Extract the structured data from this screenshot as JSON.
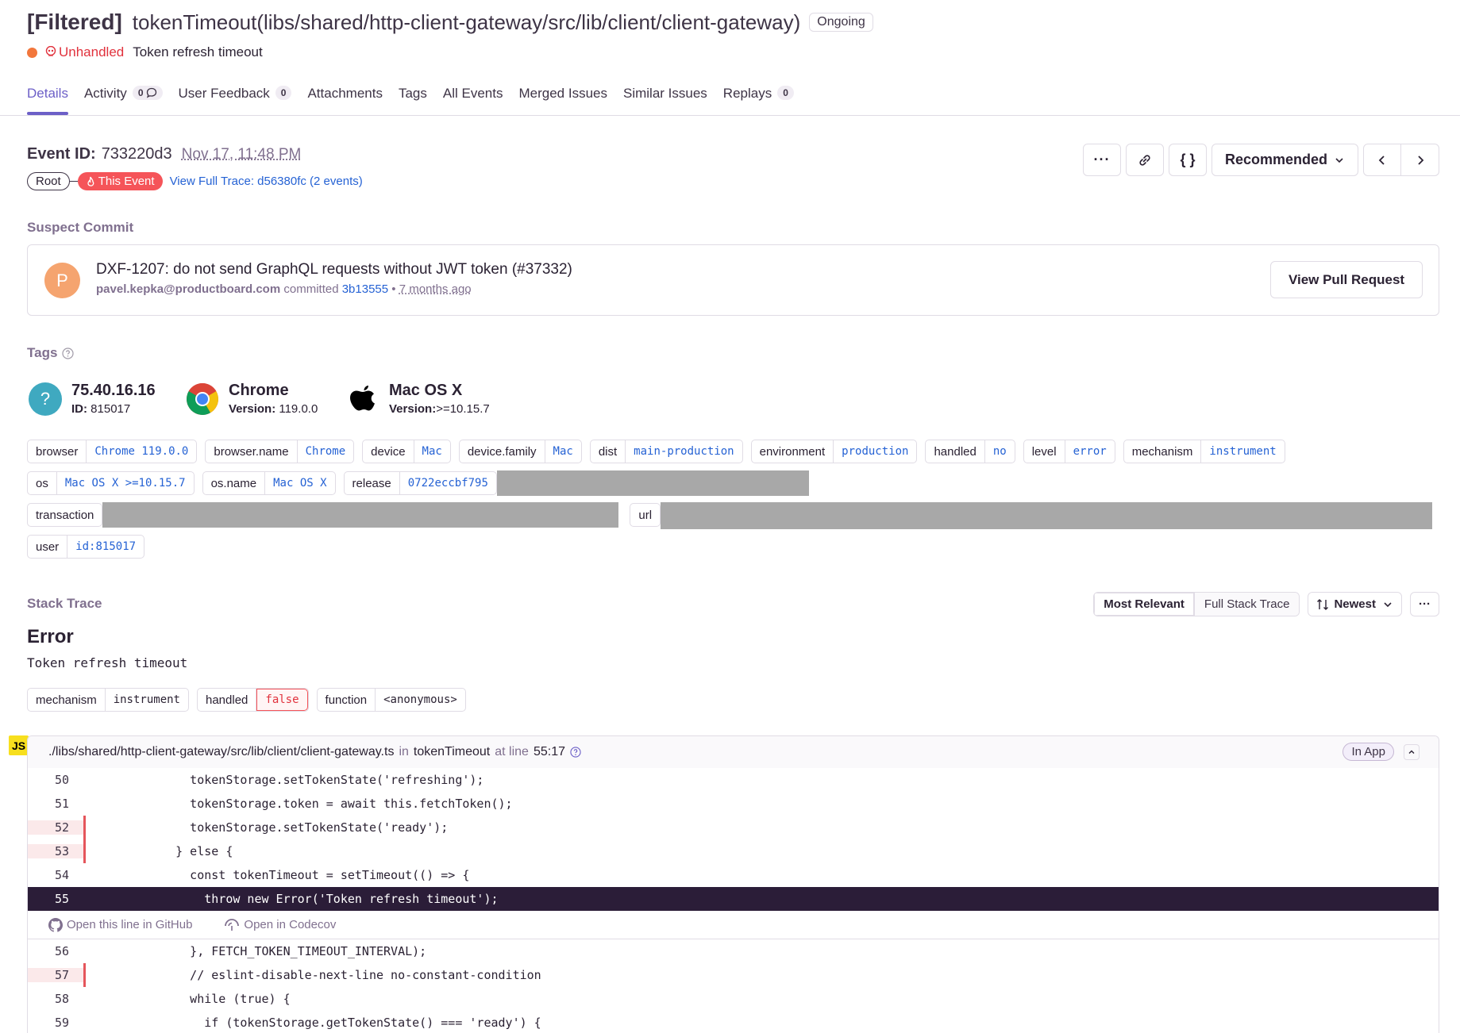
{
  "header": {
    "title_prefix": "[Filtered]",
    "title": "tokenTimeout(libs/shared/http-client-gateway/src/lib/client/client-gateway)",
    "status": "Ongoing",
    "level_label": "Unhandled",
    "message": "Token refresh timeout",
    "tabs": [
      {
        "label": "Details"
      },
      {
        "label": "Activity",
        "count": "0"
      },
      {
        "label": "User Feedback",
        "count": "0"
      },
      {
        "label": "Attachments"
      },
      {
        "label": "Tags"
      },
      {
        "label": "All Events"
      },
      {
        "label": "Merged Issues"
      },
      {
        "label": "Similar Issues"
      },
      {
        "label": "Replays",
        "count": "0"
      }
    ]
  },
  "event": {
    "label": "Event ID:",
    "id": "733220d3",
    "date": "Nov 17, 11:48 PM",
    "root": "Root",
    "this_event": "This Event",
    "trace_link": "View Full Trace: d56380fc (2 events)",
    "sort": "Recommended"
  },
  "suspect": {
    "title": "Suspect Commit",
    "avatar_letter": "P",
    "message": "DXF-1207: do not send GraphQL requests without JWT token (#37332)",
    "author": "pavel.kepka@productboard.com",
    "committed": "committed",
    "hash": "3b13555",
    "sep": "•",
    "ago": "7 months ago",
    "button": "View Pull Request"
  },
  "tags": {
    "title": "Tags",
    "highlights": [
      {
        "title": "75.40.16.16",
        "sub_label": "ID:",
        "sub_value": "815017",
        "icon": "unknown-user-icon"
      },
      {
        "title": "Chrome",
        "sub_label": "Version:",
        "sub_value": "119.0.0",
        "icon": "chrome-icon"
      },
      {
        "title": "Mac OS X",
        "sub_label": "Version:",
        "sub_value": ">=10.15.7",
        "icon": "apple-icon"
      }
    ],
    "row1": [
      {
        "k": "browser",
        "v": "Chrome 119.0.0"
      },
      {
        "k": "browser.name",
        "v": "Chrome"
      },
      {
        "k": "device",
        "v": "Mac"
      },
      {
        "k": "device.family",
        "v": "Mac"
      },
      {
        "k": "dist",
        "v": "main-production"
      },
      {
        "k": "environment",
        "v": "production"
      },
      {
        "k": "handled",
        "v": "no"
      },
      {
        "k": "level",
        "v": "error"
      },
      {
        "k": "mechanism",
        "v": "instrument"
      }
    ],
    "row2": [
      {
        "k": "os",
        "v": "Mac OS X >=10.15.7"
      },
      {
        "k": "os.name",
        "v": "Mac OS X"
      },
      {
        "k": "release",
        "v": "0722eccbf795"
      }
    ],
    "transaction_key": "transaction",
    "url_key": "url",
    "user_key": "user",
    "user_value": "id:815017"
  },
  "stack": {
    "title": "Stack Trace",
    "mode_on": "Most Relevant",
    "mode_off": "Full Stack Trace",
    "order": "Newest",
    "error_type": "Error",
    "error_message": "Token refresh timeout",
    "mini_tags": [
      {
        "k": "mechanism",
        "v": "instrument"
      },
      {
        "k": "handled",
        "v": "false"
      },
      {
        "k": "function",
        "v": "<anonymous>"
      }
    ],
    "frame": {
      "lang": "JS",
      "file": "./libs/shared/http-client-gateway/src/lib/client/client-gateway.ts",
      "in": "in",
      "function": "tokenTimeout",
      "at_line": "at line",
      "line": "55:17",
      "in_app": "In App"
    },
    "code": [
      {
        "n": "50",
        "t": "      tokenStorage.setTokenState('refreshing');"
      },
      {
        "n": "51",
        "t": "      tokenStorage.token = await this.fetchToken();"
      },
      {
        "n": "52",
        "t": "      tokenStorage.setTokenState('ready');"
      },
      {
        "n": "53",
        "t": "    } else {"
      },
      {
        "n": "54",
        "t": "      const tokenTimeout = setTimeout(() => {"
      },
      {
        "n": "55",
        "t": "        throw new Error('Token refresh timeout');"
      }
    ],
    "links": {
      "github": "Open this line in GitHub",
      "codecov": "Open in Codecov"
    },
    "code2": [
      {
        "n": "56",
        "t": "      }, FETCH_TOKEN_TIMEOUT_INTERVAL);"
      },
      {
        "n": "57",
        "t": "      // eslint-disable-next-line no-constant-condition"
      },
      {
        "n": "58",
        "t": "      while (true) {"
      },
      {
        "n": "59",
        "t": "        if (tokenStorage.getTokenState() === 'ready') {"
      }
    ]
  }
}
